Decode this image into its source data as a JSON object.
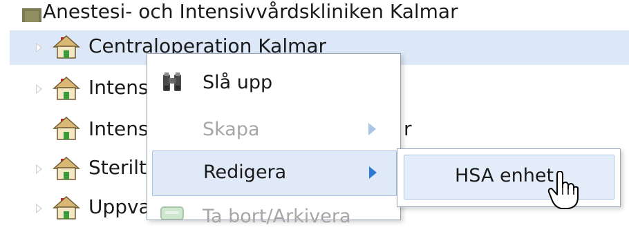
{
  "tree": {
    "parent_label": "Anestesi- och Intensivvårdskliniken Kalmar",
    "rows": [
      {
        "label": "Centraloperation Kalmar",
        "selected": true,
        "expandable": true,
        "icon": "house-icon"
      },
      {
        "label": "Intens",
        "selected": false,
        "expandable": true,
        "icon": "house-icon"
      },
      {
        "label": "Intens",
        "trailing": "r",
        "selected": false,
        "expandable": false,
        "icon": "house-icon"
      },
      {
        "label": "Sterilte",
        "selected": false,
        "expandable": true,
        "icon": "house-icon"
      },
      {
        "label": "Uppva",
        "selected": false,
        "expandable": true,
        "icon": "house-icon"
      }
    ]
  },
  "context_menu": {
    "items": [
      {
        "label": "Slå upp",
        "icon": "binoculars-icon",
        "enabled": true,
        "submenu": false
      },
      {
        "label": "Skapa",
        "icon": "",
        "enabled": false,
        "submenu": true
      },
      {
        "label": "Redigera",
        "icon": "",
        "enabled": true,
        "submenu": true,
        "highlighted": true
      },
      {
        "label": "Ta bort/Arkivera",
        "icon": "archive-icon",
        "enabled": false,
        "submenu": false
      }
    ]
  },
  "submenu": {
    "items": [
      {
        "label": "HSA enhet",
        "highlighted": true
      }
    ]
  },
  "colors": {
    "selection": "#dce8f8",
    "menu_highlight": "#dfe9f7",
    "menu_border": "#9aa5b4",
    "disabled_text": "#a6a6a6",
    "submenu_arrow_active": "#2f7ad3"
  }
}
